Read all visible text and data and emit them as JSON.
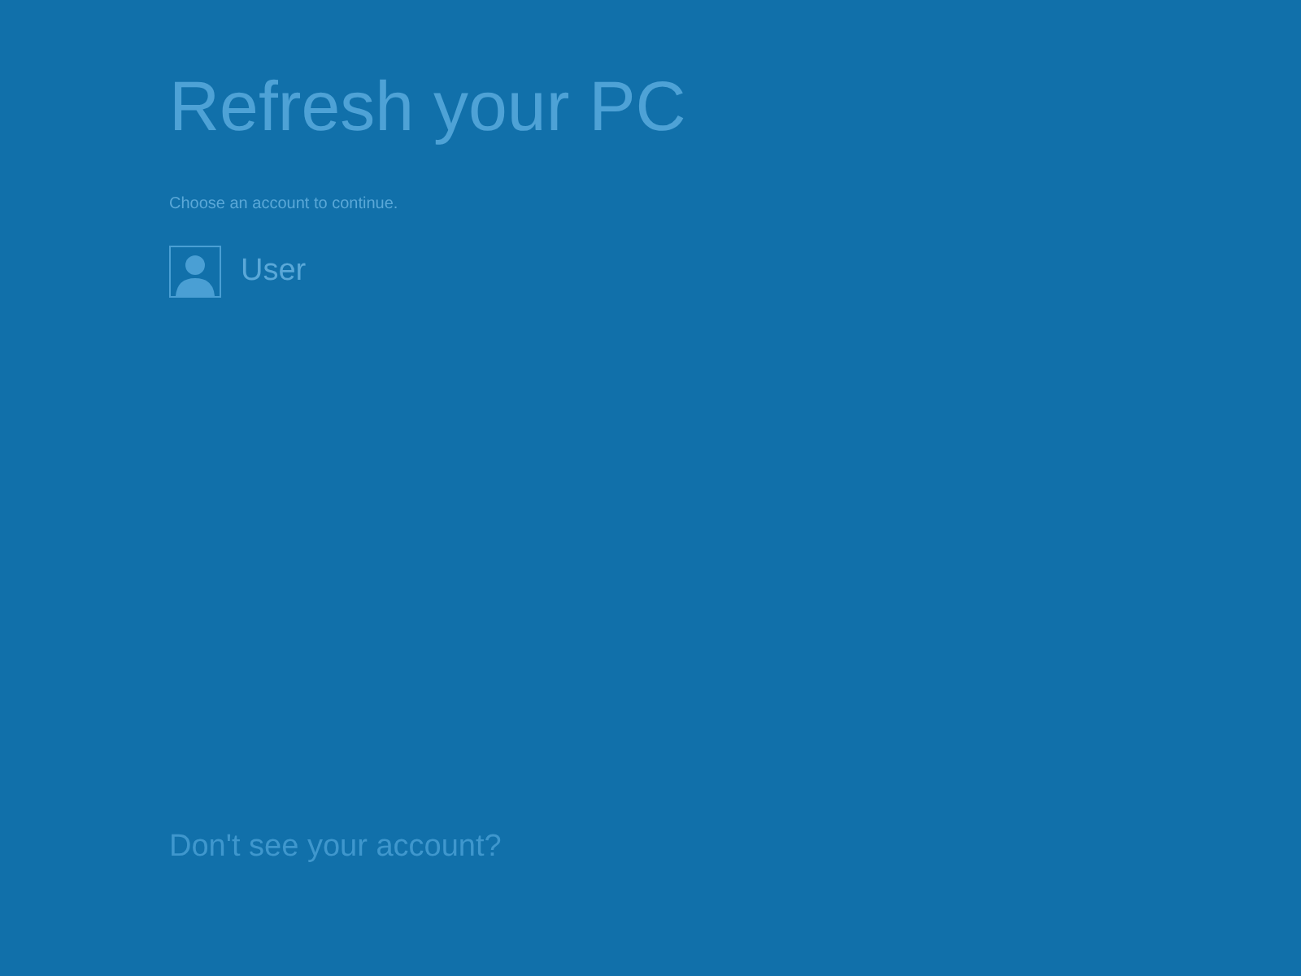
{
  "title": "Refresh your PC",
  "subtitle": "Choose an account to continue.",
  "accounts": [
    {
      "name": "User"
    }
  ],
  "link": "Don't see your account?"
}
